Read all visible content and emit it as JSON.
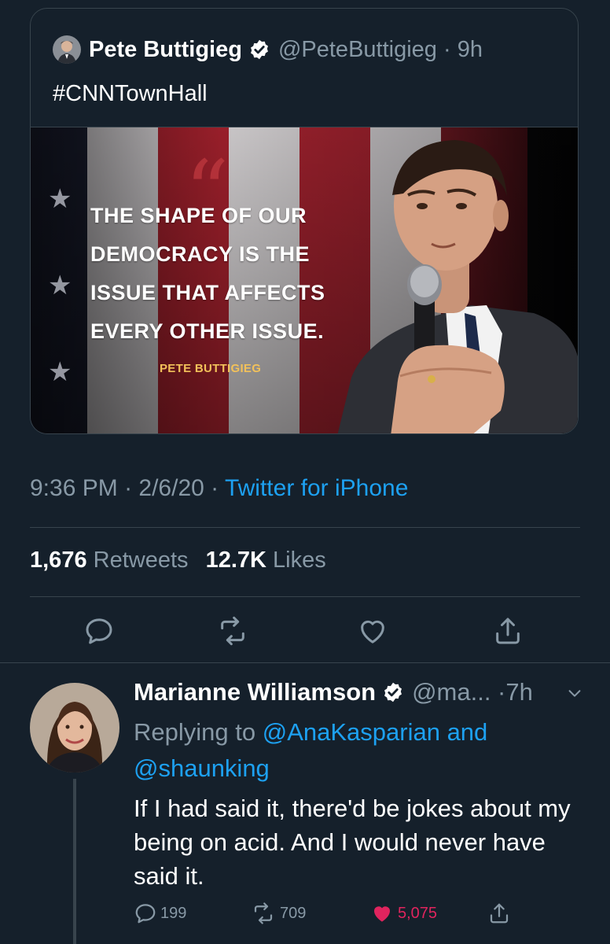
{
  "quoted": {
    "name": "Pete Buttigieg",
    "handle": "@PeteButtigieg",
    "time": "9h",
    "text": "#CNNTownHall",
    "image_quote_lines": [
      "THE SHAPE OF OUR",
      "DEMOCRACY IS THE",
      "ISSUE THAT AFFECTS",
      "EVERY OTHER ISSUE."
    ],
    "image_attribution": "PETE BUTTIGIEG"
  },
  "meta": {
    "time": "9:36 PM",
    "date": "2/6/20",
    "source": "Twitter for iPhone"
  },
  "stats": {
    "retweets_count": "1,676",
    "retweets_label": "Retweets",
    "likes_count": "12.7K",
    "likes_label": "Likes"
  },
  "actions": {
    "icons": [
      "reply-icon",
      "retweet-icon",
      "like-icon",
      "share-icon"
    ]
  },
  "reply": {
    "name": "Marianne Williamson",
    "handle": "@ma...",
    "time": "7h",
    "replying_prefix": "Replying to",
    "mention1": "@AnaKasparian",
    "and_word": "and",
    "mention2": "@shaunking",
    "body": "If I had said it, there'd be jokes about my being on acid. And I would never have said it.",
    "reply_count": "199",
    "retweet_count": "709",
    "like_count": "5,075"
  },
  "colors": {
    "background": "#15202b",
    "border": "#38444d",
    "muted": "#8899a6",
    "link": "#1da1f2",
    "like": "#e0245e"
  }
}
